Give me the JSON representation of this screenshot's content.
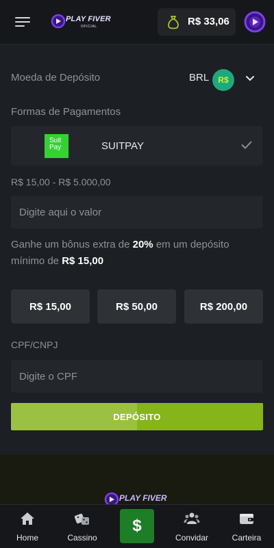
{
  "header": {
    "logo_text": "PLAY FIVER",
    "logo_subtext": "OFICIAL",
    "balance": "R$ 33,06"
  },
  "deposit": {
    "currency_label": "Moeda de Depósito",
    "currency_code": "BRL",
    "currency_symbol": "R$",
    "payment_methods_label": "Formas de Pagamentos",
    "method": {
      "logo_text": "Suit Pay",
      "name": "SUITPAY",
      "selected": true
    },
    "range_label": "R$ 15,00 - R$ 5.000,00",
    "amount_placeholder": "Digite aqui o valor",
    "bonus": {
      "text_before": "Ganhe um bônus extra de ",
      "percent": "20%",
      "text_middle": " em um depósito mínimo de ",
      "minimum": "R$ 15,00"
    },
    "quick_amounts": [
      "R$ 15,00",
      "R$ 50,00",
      "R$ 200,00"
    ],
    "cpf_label": "CPF/CNPJ",
    "cpf_placeholder": "Digite o CPF",
    "submit_label": "DEPÓSITO"
  },
  "footer": {
    "logo_text": "PLAY FIVER"
  },
  "bottom_nav": {
    "items": [
      {
        "label": "Home",
        "icon": "home-icon"
      },
      {
        "label": "Cassino",
        "icon": "dice-icon"
      },
      {
        "label": "",
        "icon": "dollar-icon"
      },
      {
        "label": "Convidar",
        "icon": "users-icon"
      },
      {
        "label": "Carteira",
        "icon": "wallet-icon"
      }
    ],
    "center_symbol": "$"
  },
  "colors": {
    "background": "#1c1f23",
    "accent_green": "#86b41b",
    "brand_purple": "#6a2bd6",
    "nav_center": "#1e7d27",
    "suitpay_green": "#33d233"
  }
}
